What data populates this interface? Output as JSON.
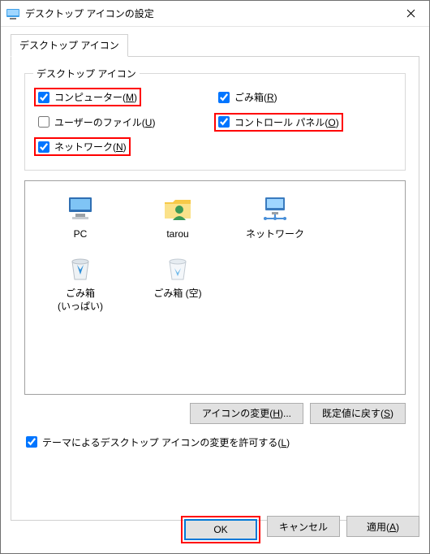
{
  "title": "デスクトップ アイコンの設定",
  "tab": {
    "label": "デスクトップ アイコン"
  },
  "group": {
    "label": "デスクトップ アイコン",
    "checks": {
      "computer": {
        "label_pre": "コンピューター(",
        "accel": "M",
        "label_post": ")",
        "checked": true
      },
      "recycle": {
        "label_pre": "ごみ箱(",
        "accel": "R",
        "label_post": ")",
        "checked": true
      },
      "userfiles": {
        "label_pre": "ユーザーのファイル(",
        "accel": "U",
        "label_post": ")",
        "checked": false
      },
      "control": {
        "label_pre": "コントロール パネル(",
        "accel": "O",
        "label_post": ")",
        "checked": true
      },
      "network": {
        "label_pre": "ネットワーク(",
        "accel": "N",
        "label_post": ")",
        "checked": true
      }
    }
  },
  "icons": {
    "pc": "PC",
    "user": "tarou",
    "network": "ネットワーク",
    "bin_full_l1": "ごみ箱",
    "bin_full_l2": "(いっぱい)",
    "bin_empty": "ごみ箱 (空)"
  },
  "buttons": {
    "change_icon_pre": "アイコンの変更(",
    "change_icon_accel": "H",
    "change_icon_post": ")...",
    "restore_pre": "既定値に戻す(",
    "restore_accel": "S",
    "restore_post": ")"
  },
  "theme_check": {
    "label_pre": "テーマによるデスクトップ アイコンの変更を許可する(",
    "accel": "L",
    "post": ")",
    "checked": true
  },
  "dlg": {
    "ok": "OK",
    "cancel": "キャンセル",
    "apply_pre": "適用(",
    "apply_accel": "A",
    "apply_post": ")"
  }
}
